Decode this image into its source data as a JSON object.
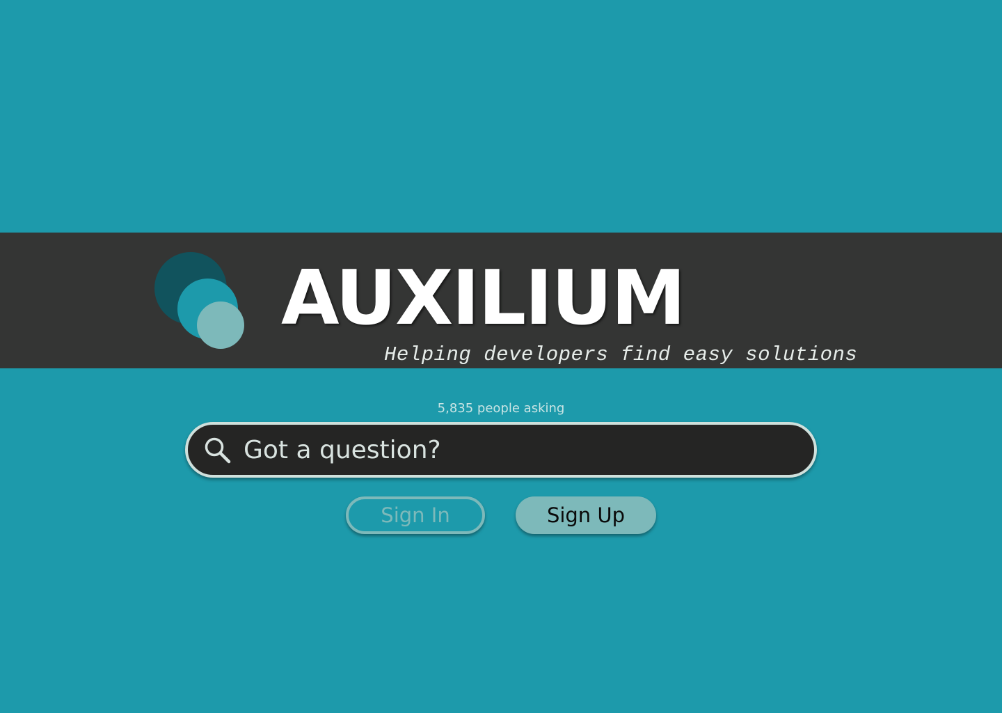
{
  "brand": {
    "title": "AUXILIUM",
    "tagline": "Helping developers find easy solutions",
    "logo_icon": "three-overlapping-circles-logo"
  },
  "stats": {
    "asking_text": "5,835 people asking"
  },
  "search": {
    "placeholder": "Got a question?",
    "value": "",
    "icon": "search-icon"
  },
  "auth": {
    "sign_in_label": "Sign In",
    "sign_up_label": "Sign Up"
  },
  "colors": {
    "background": "#1d9aab",
    "banner": "#343534",
    "logo_dark": "#11535d",
    "logo_mid": "#1d9aab",
    "logo_light": "#7db9ba",
    "search_bg": "#252524",
    "search_border": "#cfe0dc",
    "button_accent": "#7db9ba"
  }
}
